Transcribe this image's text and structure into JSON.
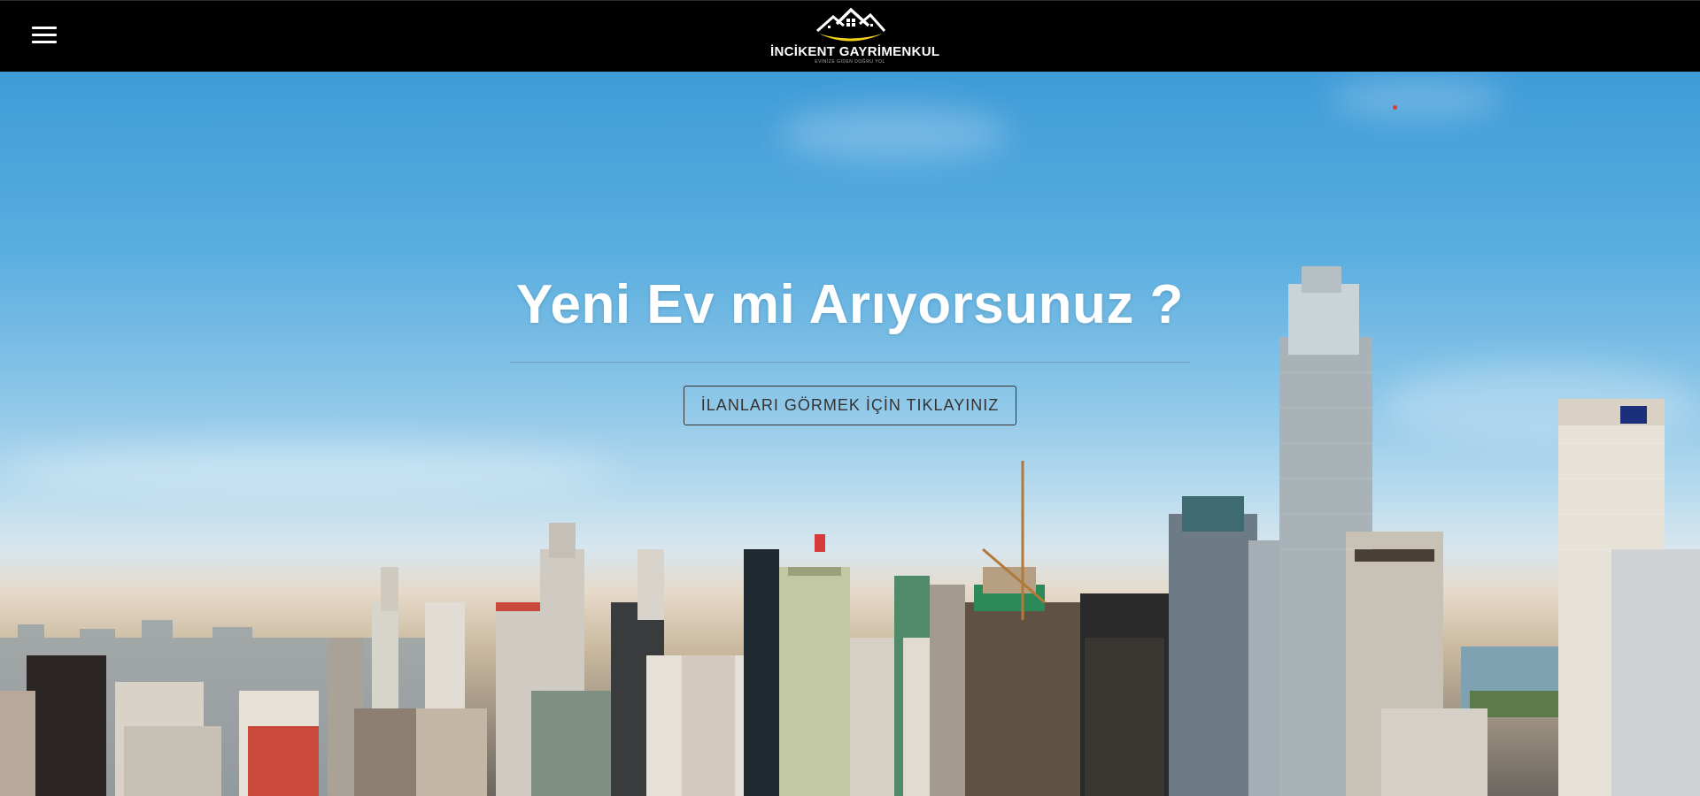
{
  "navbar": {
    "menu_icon": "hamburger-menu-icon",
    "logo": {
      "name": "İNCİKENT GAYRİMENKUL",
      "tagline": "EVİNİZE GİDEN DOĞRU YOL"
    }
  },
  "hero": {
    "title": "Yeni Ev mi Arıyorsunuz ?",
    "cta_label": "İLANLARI GÖRMEK İÇİN TIKLAYINIZ",
    "background": "city-skyline-photo"
  },
  "colors": {
    "navbar_bg": "#000000",
    "logo_accent": "#f2d21b",
    "title_text": "#ffffff",
    "button_border": "#333333"
  }
}
